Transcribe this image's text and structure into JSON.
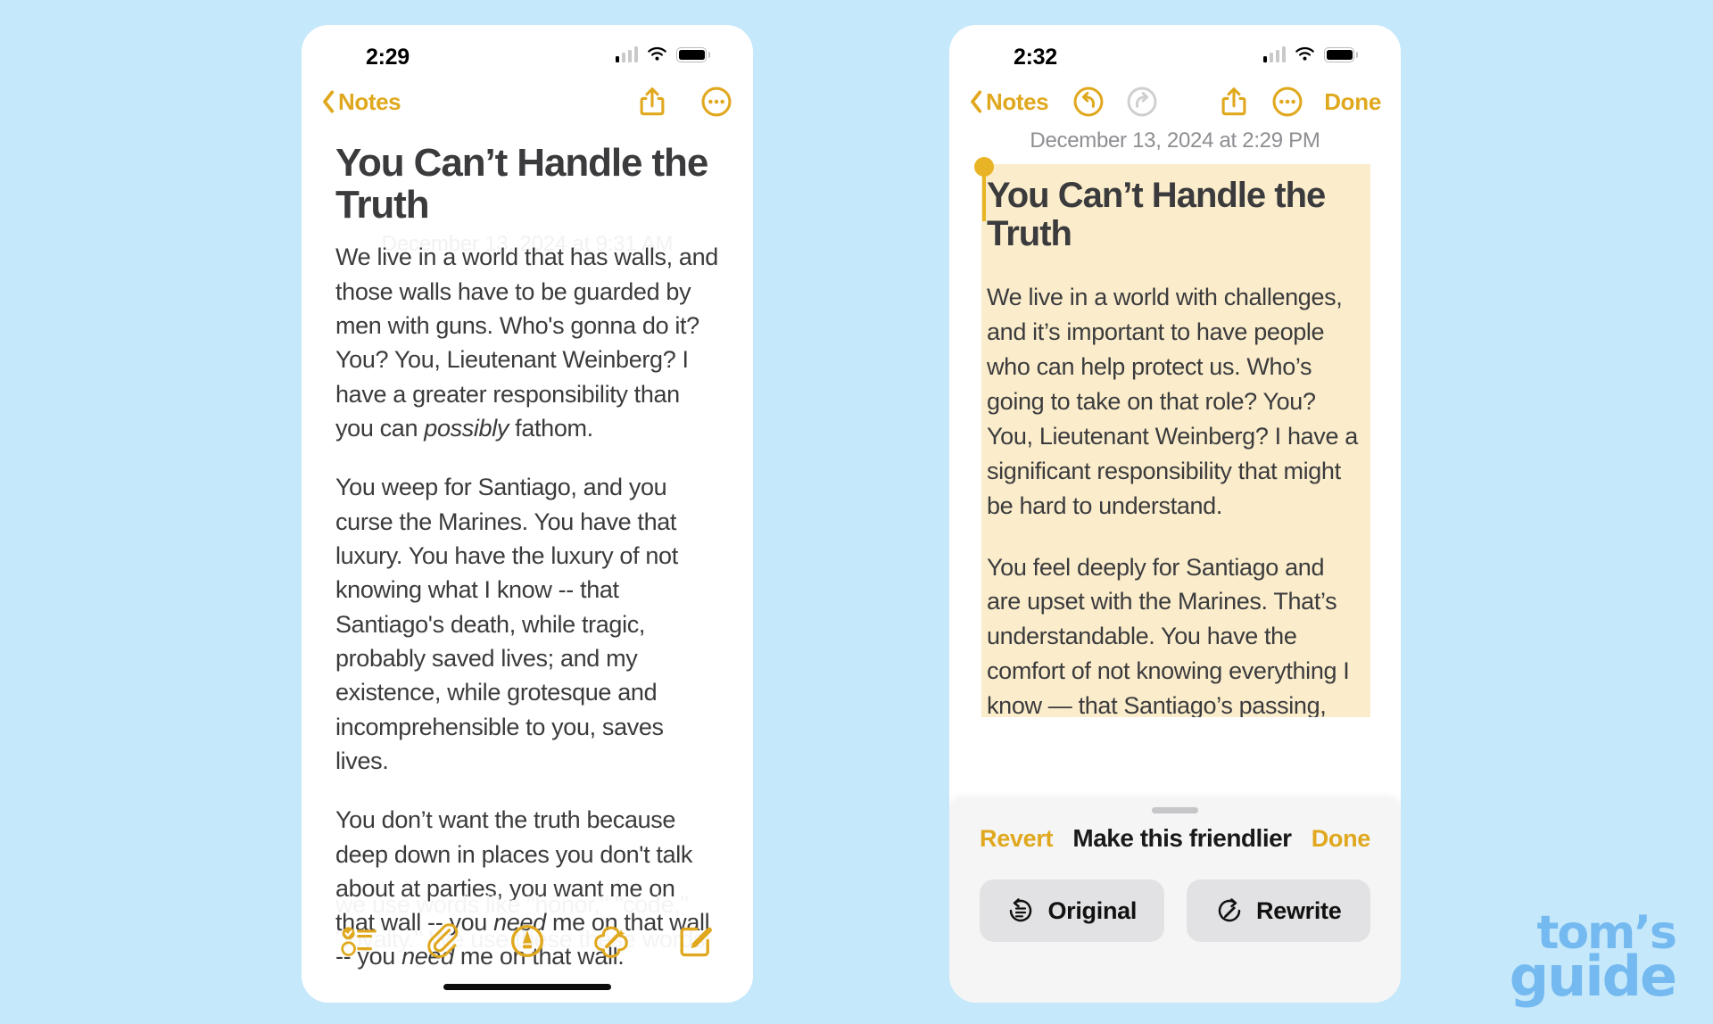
{
  "background_color": "#c5e8fb",
  "accent_color": "#e0a81e",
  "highlight_color": "#fbedcb",
  "phone_left": {
    "status": {
      "time": "2:29",
      "signal_bars_filled": 1,
      "signal_bars_total": 4,
      "wifi": "wifi-icon",
      "battery": "battery-full-icon"
    },
    "nav": {
      "back_label": "Notes",
      "share_icon": "share-icon",
      "more_icon": "more-ellipsis-icon"
    },
    "ghost_date": "December 13, 2024 at 9:31 AM",
    "note": {
      "title": "You Can’t Handle the Truth",
      "paragraphs": [
        "We live in a world that has walls, and those walls have to be guarded by men with guns. Who's gonna do it? You? You, Lieutenant Weinberg? I have a greater responsibility than you can ",
        "You weep for Santiago, and you curse the Marines. You have that luxury. You have the luxury of not knowing what I know -- that Santiago's death, while tragic, probably saved lives; and my existence, while grotesque and incomprehensible to you, saves lives.",
        "You don’t want the truth because deep down in places  you don't talk about at parties, you want me on that wall -- you "
      ],
      "p1_italic": "possibly",
      "p1_tail": " fathom.",
      "p3_italic_a": "need",
      "p3_mid": " me on that wall -- you ",
      "p3_italic_b": "need",
      "p3_tail": " me on that wall."
    },
    "ghost_tail": "we use words like \"honor,\" \"code,\" \"loyalty.\" We use these these words",
    "toolbar": [
      {
        "name": "checklist-icon",
        "label": "Checklist"
      },
      {
        "name": "attachment-paperclip-icon",
        "label": "Attach"
      },
      {
        "name": "markup-pen-icon",
        "label": "Markup"
      },
      {
        "name": "apple-intelligence-sparkle-icon",
        "label": "Apple Intelligence"
      },
      {
        "name": "compose-icon",
        "label": "Compose"
      }
    ]
  },
  "phone_right": {
    "status": {
      "time": "2:32",
      "signal_bars_filled": 1,
      "signal_bars_total": 4,
      "wifi": "wifi-icon",
      "battery": "battery-full-icon"
    },
    "nav": {
      "back_label": "Notes",
      "undo_icon": "undo-icon",
      "undo_enabled": true,
      "redo_icon": "redo-icon",
      "redo_enabled": false,
      "share_icon": "share-icon",
      "more_icon": "more-ellipsis-icon",
      "done_label": "Done"
    },
    "date_line": "December 13, 2024 at 2:29 PM",
    "rewritten": {
      "title": "You Can’t Handle the Truth",
      "paragraphs": [
        "We live in a world with challenges, and it’s important to have people who can help protect us. Who’s going to take on that role? You? You, Lieutenant Weinberg? I have a significant responsibility that might be hard to understand.",
        "You feel deeply for Santiago and are upset with the Marines. That’s understandable. You have the comfort of not knowing everything I know — that Santiago’s passing, though sad, might have helped save others; and my role, while difficult and complex to you, helps save lives."
      ]
    },
    "sheet": {
      "revert_label": "Revert",
      "title": "Make this friendlier",
      "done_label": "Done",
      "buttons": [
        {
          "label": "Original",
          "icon": "original-restore-icon"
        },
        {
          "label": "Rewrite",
          "icon": "rewrite-pencil-icon"
        }
      ]
    }
  },
  "watermark": {
    "line1": "tom’s",
    "line2": "guide"
  }
}
